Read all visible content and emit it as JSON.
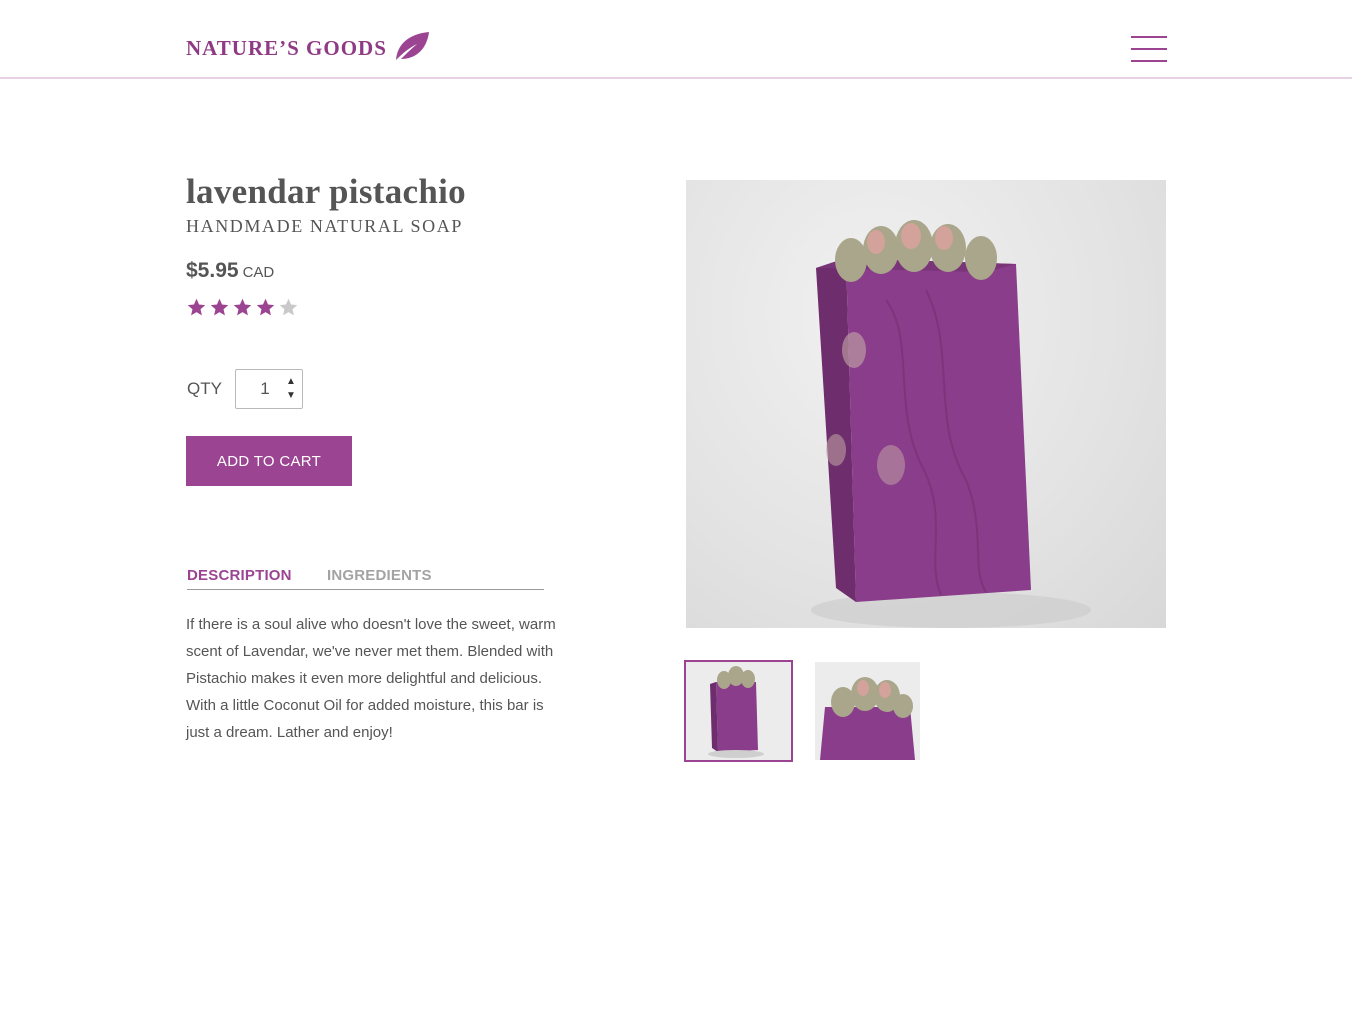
{
  "header": {
    "logo_text": "NATURE’S GOODS",
    "logo_icon": "leaf-icon",
    "menu_icon": "hamburger-menu-icon"
  },
  "product": {
    "title": "lavendar pistachio",
    "subtitle": "HANDMADE NATURAL SOAP",
    "price": "$5.95",
    "currency": "CAD",
    "rating": 4,
    "rating_max": 5
  },
  "quantity": {
    "label": "QTY",
    "value": "1"
  },
  "add_to_cart_label": "ADD TO CART",
  "tabs": [
    {
      "label": "DESCRIPTION",
      "active": true
    },
    {
      "label": "INGREDIENTS",
      "active": false
    }
  ],
  "description": "If there is a soul alive who doesn't love the sweet, warm scent of Lavendar, we've never met them. Blended with Pistachio makes it even more delightful and delicious. With a little Coconut Oil for added moisture, this bar is just a dream. Lather and enjoy!",
  "colors": {
    "accent": "#9b4592",
    "star_on": "#9b4592",
    "star_off": "#c9c9c9",
    "text": "#555555"
  }
}
